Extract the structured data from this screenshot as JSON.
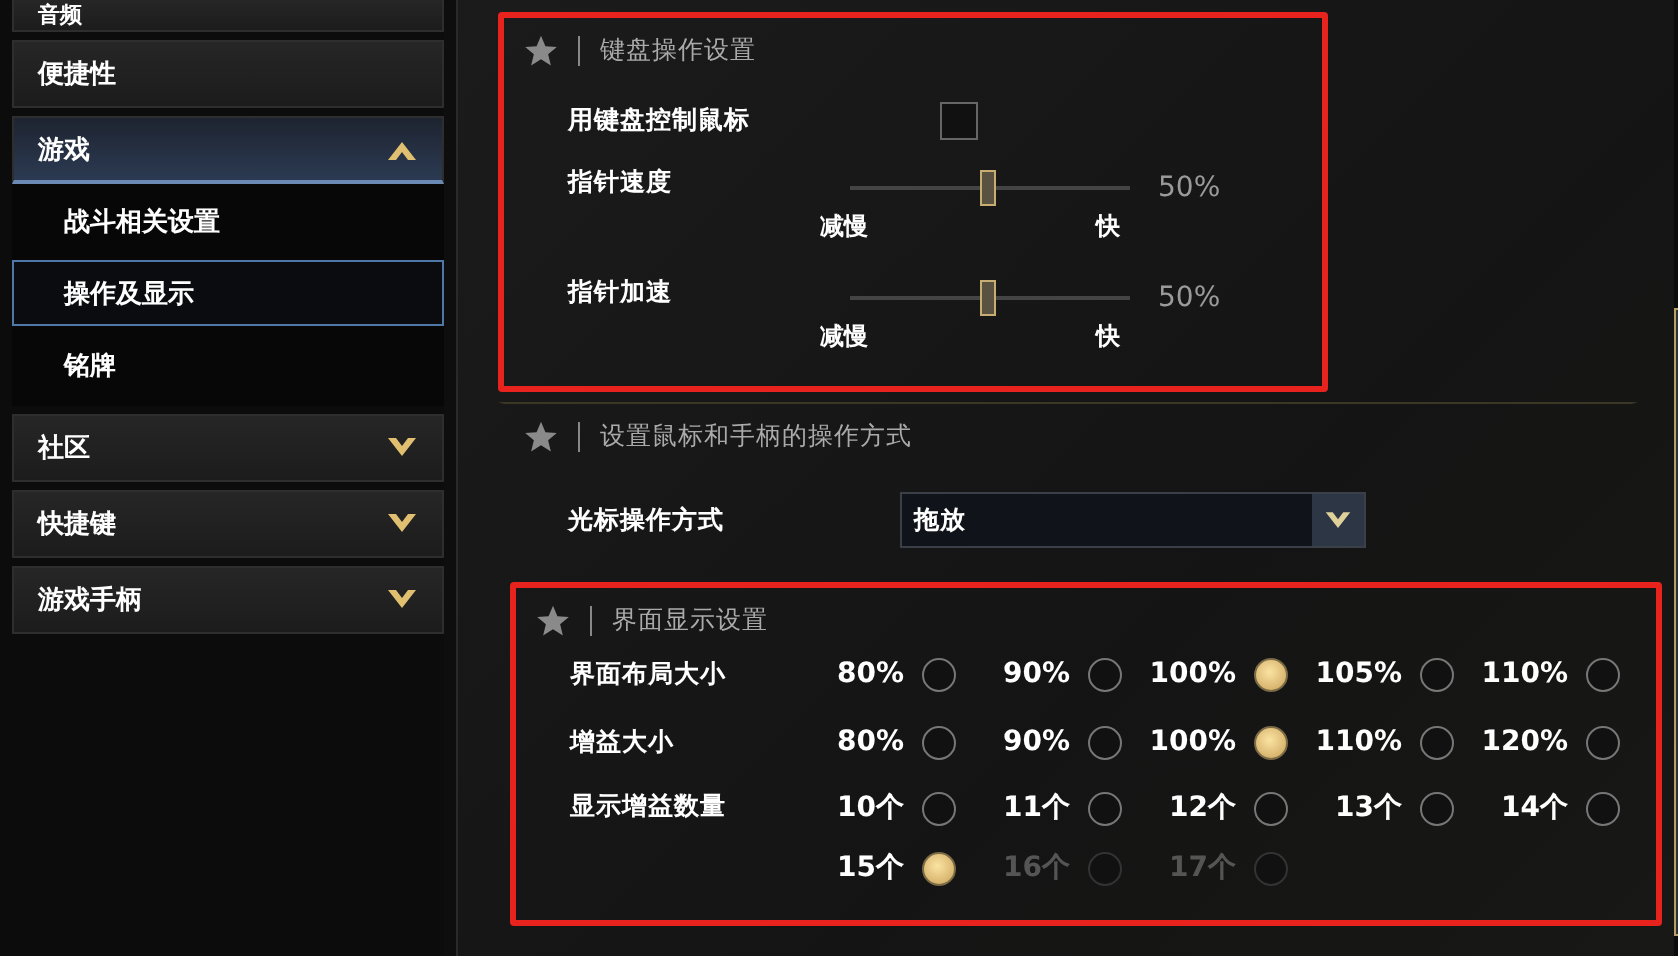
{
  "sidebar": {
    "items": [
      {
        "label": "音频",
        "kind": "top",
        "expanded": false,
        "selected": false
      },
      {
        "label": "便捷性",
        "kind": "plain",
        "expanded": false,
        "selected": false
      },
      {
        "label": "游戏",
        "kind": "group",
        "expanded": true,
        "selected": false,
        "children": [
          {
            "label": "战斗相关设置",
            "selected": false
          },
          {
            "label": "操作及显示",
            "selected": true
          },
          {
            "label": "铭牌",
            "selected": false
          }
        ]
      },
      {
        "label": "社区",
        "kind": "group",
        "expanded": false,
        "selected": false
      },
      {
        "label": "快捷键",
        "kind": "group",
        "expanded": false,
        "selected": false
      },
      {
        "label": "游戏手柄",
        "kind": "group",
        "expanded": false,
        "selected": false
      }
    ]
  },
  "sections": [
    {
      "title": "键盘操作设置",
      "highlighted": true,
      "rows": [
        {
          "kind": "checkbox",
          "label": "用键盘控制鼠标",
          "checked": false
        },
        {
          "kind": "slider",
          "label": "指针速度",
          "level": 0.5,
          "reading": "50%",
          "min_label": "减慢",
          "max_label": "快"
        },
        {
          "kind": "slider",
          "label": "指针加速",
          "level": 0.5,
          "reading": "50%",
          "min_label": "减慢",
          "max_label": "快"
        }
      ]
    },
    {
      "title": "设置鼠标和手柄的操作方式",
      "highlighted": false,
      "rows": [
        {
          "kind": "dropdown",
          "label": "光标操作方式",
          "value": "拖放"
        }
      ]
    },
    {
      "title": "界面显示设置",
      "highlighted": true,
      "rows": [
        {
          "kind": "radio",
          "label": "界面布局大小",
          "options": [
            {
              "label": "80%",
              "selected": false,
              "disabled": false
            },
            {
              "label": "90%",
              "selected": false,
              "disabled": false
            },
            {
              "label": "100%",
              "selected": true,
              "disabled": false
            },
            {
              "label": "105%",
              "selected": false,
              "disabled": false
            },
            {
              "label": "110%",
              "selected": false,
              "disabled": false
            }
          ]
        },
        {
          "kind": "radio",
          "label": "增益大小",
          "options": [
            {
              "label": "80%",
              "selected": false,
              "disabled": false
            },
            {
              "label": "90%",
              "selected": false,
              "disabled": false
            },
            {
              "label": "100%",
              "selected": true,
              "disabled": false
            },
            {
              "label": "110%",
              "selected": false,
              "disabled": false
            },
            {
              "label": "120%",
              "selected": false,
              "disabled": false
            }
          ]
        },
        {
          "kind": "radio",
          "label": "显示增益数量",
          "options": [
            {
              "label": "10个",
              "selected": false,
              "disabled": false
            },
            {
              "label": "11个",
              "selected": false,
              "disabled": false
            },
            {
              "label": "12个",
              "selected": false,
              "disabled": false
            },
            {
              "label": "13个",
              "selected": false,
              "disabled": false
            },
            {
              "label": "14个",
              "selected": false,
              "disabled": false
            },
            {
              "label": "15个",
              "selected": true,
              "disabled": false
            },
            {
              "label": "16个",
              "selected": false,
              "disabled": true
            },
            {
              "label": "17个",
              "selected": false,
              "disabled": true
            }
          ]
        }
      ]
    }
  ]
}
